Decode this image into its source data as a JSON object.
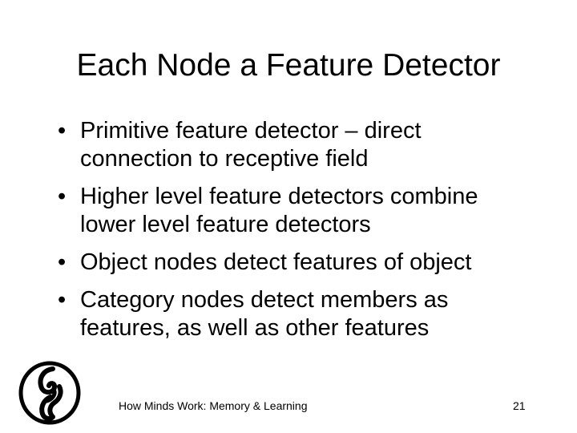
{
  "slide": {
    "title": "Each Node a Feature Detector",
    "bullets": [
      "Primitive feature detector – direct connection to receptive field",
      "Higher level feature detectors combine lower level feature detectors",
      "Object nodes detect features of object",
      "Category nodes detect members as features, as well as other features"
    ],
    "bullet_marker": "•",
    "logo_icon": "swirl-logo-icon"
  },
  "footer": {
    "course_title": "How Minds Work: Memory & Learning",
    "page_number": "21"
  }
}
